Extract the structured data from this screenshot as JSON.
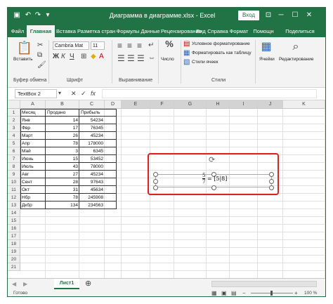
{
  "titlebar": {
    "title": "Диаграмма в диаграмме.xlsx  -  Excel",
    "signin": "Вход"
  },
  "tabs": [
    "Файл",
    "Главная",
    "Вставка",
    "Разметка стран",
    "Формулы",
    "Данные",
    "Рецензирование",
    "Вид",
    "Справка",
    "Формат",
    "Помощн",
    "Поделиться"
  ],
  "ribbon": {
    "paste": "Вставить",
    "font_name": "Cambria Mat",
    "font_size": "11",
    "number_label": "Число",
    "percent": "%",
    "cond_format": "Условное форматирование",
    "table_format": "Форматировать как таблицу",
    "cell_styles": "Стили ячеек",
    "cells": "Ячейки",
    "editing": "Редактирование",
    "group_clipboard": "Буфер обмена",
    "group_font": "Шрифт",
    "group_align": "Выравнивание",
    "group_styles": "Стили"
  },
  "formula": {
    "namebox": "TextBox 2",
    "fx": "fx"
  },
  "columns": [
    "A",
    "B",
    "C",
    "D",
    "E",
    "F",
    "G",
    "H",
    "I",
    "J",
    "K"
  ],
  "rows": [
    "1",
    "2",
    "3",
    "4",
    "5",
    "6",
    "7",
    "8",
    "9",
    "10",
    "11",
    "12",
    "13",
    "14",
    "15",
    "16",
    "17",
    "18",
    "19",
    "20",
    "21"
  ],
  "table": {
    "header": [
      "Месяц",
      "Продано",
      "Прибыль"
    ],
    "rows": [
      [
        "Янв",
        "14",
        "54234"
      ],
      [
        "Фвр",
        "17",
        "76345"
      ],
      [
        "Март",
        "26",
        "45234"
      ],
      [
        "Апр",
        "78",
        "178000"
      ],
      [
        "Май",
        "3",
        "6345"
      ],
      [
        "Июнь",
        "15",
        "53452"
      ],
      [
        "Июль",
        "43",
        "78000"
      ],
      [
        "Авг",
        "27",
        "45234"
      ],
      [
        "Сент",
        "28",
        "97643"
      ],
      [
        "Окт",
        "31",
        "45634"
      ],
      [
        "Нбр",
        "78",
        "245908"
      ],
      [
        "Дкбр",
        "134",
        "234563"
      ]
    ]
  },
  "textbox": {
    "num": "5",
    "den": "7",
    "rest": "= [5|8]"
  },
  "sheet": {
    "name": "Лист1"
  },
  "status": {
    "ready": "Готово",
    "zoom": "100 %"
  }
}
